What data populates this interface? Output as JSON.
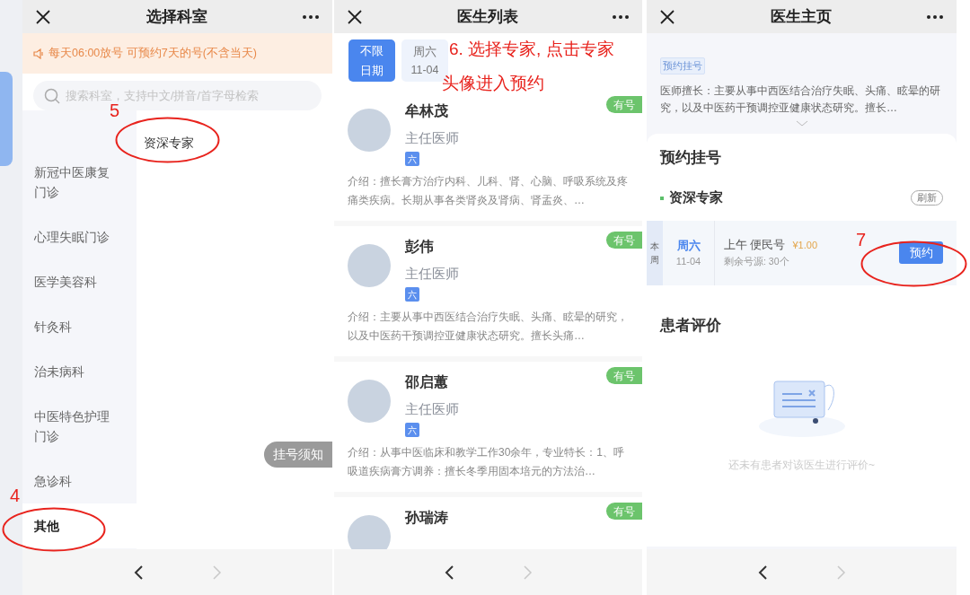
{
  "department_screen": {
    "title": "选择科室",
    "notice": "每天06:00放号 可预约7天的号(不含当天)",
    "search": {
      "placeholder": "搜索科室，支持中文/拼音/首字母检索"
    },
    "departments": [
      {
        "label": "新冠中医康复门诊",
        "selected": false
      },
      {
        "label": "心理失眠门诊",
        "selected": false
      },
      {
        "label": "医学美容科",
        "selected": false
      },
      {
        "label": "针灸科",
        "selected": false
      },
      {
        "label": "治未病科",
        "selected": false
      },
      {
        "label": "中医特色护理门诊",
        "selected": false
      },
      {
        "label": "急诊科",
        "selected": false
      },
      {
        "label": "其他",
        "selected": true
      }
    ],
    "subdepartments": [
      "资深专家"
    ],
    "floating_button": "挂号须知",
    "nav": {
      "back_disabled": false,
      "forward_disabled": true
    },
    "annotations": [
      {
        "kind": "step_circle",
        "number": "5"
      },
      {
        "kind": "step_circle",
        "number": "4"
      }
    ]
  },
  "doctor_list_screen": {
    "title": "医生列表",
    "date_filters": [
      {
        "label": "不限日期",
        "selected": true
      },
      {
        "day": "周六",
        "date": "11-04",
        "selected": false
      }
    ],
    "doctors": [
      {
        "name": "牟林茂",
        "title": "主任医师",
        "tag": "六",
        "availability": "有号",
        "intro": "介绍：擅长膏方治疗内科、儿科、肾、心脑、呼吸系统及疼痛类疾病。长期从事各类肾炎及肾病、肾盂炎、…"
      },
      {
        "name": "彭伟",
        "title": "主任医师",
        "tag": "六",
        "availability": "有号",
        "intro": "介绍：主要从事中西医结合治疗失眠、头痛、眩晕的研究，以及中医药干预调控亚健康状态研究。擅长头痛…"
      },
      {
        "name": "邵启蕙",
        "title": "主任医师",
        "tag": "六",
        "availability": "有号",
        "intro": "介绍：从事中医临床和教学工作30余年，专业特长：1、呼吸道疾病膏方调养：擅长冬季用固本培元的方法治…"
      },
      {
        "name": "孙瑞涛",
        "availability": "有号"
      }
    ],
    "nav": {
      "back_disabled": false,
      "forward_disabled": true
    },
    "annotations": [
      {
        "kind": "caption",
        "lines": [
          "6. 选择专家, 点击专家",
          "头像进入预约"
        ]
      }
    ]
  },
  "doctor_home_screen": {
    "title": "医生主页",
    "tag": "预约挂号",
    "expertise": "医师擅长：主要从事中西医结合治疗失眠、头痛、眩晕的研究，以及中医药干预调控亚健康状态研究。擅长…",
    "booking": {
      "heading": "预约挂号",
      "category": "资深专家",
      "refresh": "刷新",
      "slots": [
        {
          "week": "本周",
          "day": "周六",
          "date": "11-04",
          "session": "上午 便民号",
          "price": "¥1.00",
          "remaining": "剩余号源: 30个",
          "button": "预约"
        }
      ]
    },
    "reviews": {
      "heading": "患者评价",
      "empty_text": "还未有患者对该医生进行评价~"
    },
    "nav": {
      "back_disabled": false,
      "forward_disabled": true
    },
    "annotations": [
      {
        "kind": "step_circle",
        "number": "7"
      }
    ]
  }
}
